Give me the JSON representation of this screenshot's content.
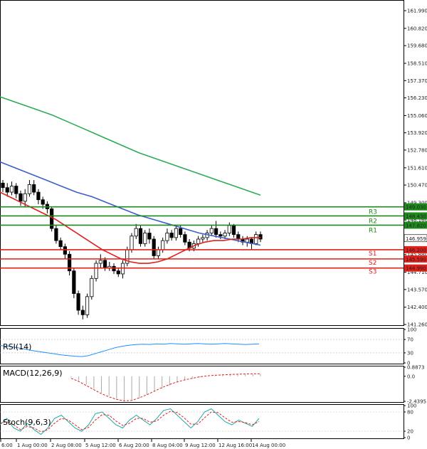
{
  "chart_data": {
    "type": "candlestick",
    "main": {
      "ylim": [
        141.26,
        162.6
      ],
      "y_ticks": [
        "161.990",
        "160.820",
        "159.680",
        "158.510",
        "157.370",
        "156.230",
        "155.060",
        "153.920",
        "152.780",
        "151.610",
        "150.470",
        "149.300",
        "148.160",
        "147.020",
        "146.959",
        "145.880",
        "144.710",
        "143.570",
        "142.400",
        "141.260"
      ],
      "current_price": {
        "label": "146.959",
        "value": 146.959
      },
      "levels": [
        {
          "name": "R3",
          "price_label": "149.030",
          "value": 149.03,
          "color": "#1e8a1e"
        },
        {
          "name": "R2",
          "price_label": "148.430",
          "value": 148.43,
          "color": "#1e8a1e"
        },
        {
          "name": "R1",
          "price_label": "147.820",
          "value": 147.82,
          "color": "#1e8a1e"
        },
        {
          "name": "S1",
          "price_label": "146.200",
          "value": 146.2,
          "color": "#e0201a"
        },
        {
          "name": "S2",
          "price_label": "145.590",
          "value": 145.59,
          "color": "#e0201a"
        },
        {
          "name": "S3",
          "price_label": "144.990",
          "value": 144.99,
          "color": "#e0201a"
        }
      ],
      "candles": [
        [
          150.6,
          150.3,
          150.8,
          150.0
        ],
        [
          150.3,
          150.0,
          150.6,
          149.7
        ],
        [
          150.0,
          150.4,
          150.7,
          149.8
        ],
        [
          150.4,
          149.9,
          150.6,
          149.6
        ],
        [
          149.9,
          149.4,
          150.1,
          149.1
        ],
        [
          149.4,
          149.9,
          150.2,
          149.0
        ],
        [
          149.9,
          150.5,
          150.8,
          149.7
        ],
        [
          150.5,
          150.0,
          150.8,
          149.8
        ],
        [
          150.0,
          149.5,
          150.2,
          149.2
        ],
        [
          149.5,
          149.2,
          149.7,
          148.9
        ],
        [
          149.2,
          148.9,
          149.4,
          148.6
        ],
        [
          148.9,
          147.6,
          149.0,
          147.4
        ],
        [
          147.6,
          146.8,
          147.8,
          146.6
        ],
        [
          146.8,
          146.4,
          147.0,
          146.2
        ],
        [
          146.4,
          145.9,
          146.6,
          145.6
        ],
        [
          145.9,
          144.8,
          146.1,
          144.5
        ],
        [
          144.8,
          143.3,
          145.0,
          143.0
        ],
        [
          143.3,
          142.2,
          143.5,
          141.9
        ],
        [
          142.2,
          141.9,
          142.5,
          141.6
        ],
        [
          141.9,
          143.1,
          143.3,
          141.7
        ],
        [
          143.1,
          144.3,
          144.5,
          142.9
        ],
        [
          144.3,
          145.3,
          145.5,
          144.1
        ],
        [
          145.3,
          145.5,
          145.9,
          145.0
        ],
        [
          145.5,
          145.0,
          145.7,
          144.8
        ],
        [
          145.0,
          145.1,
          145.4,
          144.8
        ],
        [
          145.1,
          144.8,
          145.3,
          144.6
        ],
        [
          144.8,
          144.6,
          145.0,
          144.4
        ],
        [
          144.6,
          145.3,
          145.5,
          144.3
        ],
        [
          145.3,
          146.2,
          146.4,
          145.1
        ],
        [
          146.2,
          147.1,
          147.3,
          146.0
        ],
        [
          147.1,
          147.6,
          147.9,
          146.9
        ],
        [
          147.6,
          146.6,
          147.8,
          146.4
        ],
        [
          146.6,
          147.3,
          147.5,
          146.4
        ],
        [
          147.3,
          146.9,
          147.6,
          146.6
        ],
        [
          146.9,
          145.8,
          147.1,
          145.6
        ],
        [
          145.8,
          146.2,
          146.4,
          145.6
        ],
        [
          146.2,
          146.8,
          147.0,
          146.0
        ],
        [
          146.8,
          147.3,
          147.6,
          146.6
        ],
        [
          147.3,
          147.0,
          147.5,
          146.8
        ],
        [
          147.0,
          147.6,
          147.8,
          146.8
        ],
        [
          147.6,
          147.2,
          147.8,
          147.0
        ],
        [
          147.2,
          146.7,
          147.4,
          146.5
        ],
        [
          146.7,
          146.3,
          146.9,
          146.1
        ],
        [
          146.3,
          146.6,
          146.8,
          146.1
        ],
        [
          146.6,
          146.9,
          147.1,
          146.4
        ],
        [
          146.9,
          147.0,
          147.2,
          146.7
        ],
        [
          147.0,
          147.3,
          147.5,
          146.8
        ],
        [
          147.3,
          147.6,
          147.8,
          147.1
        ],
        [
          147.6,
          147.2,
          148.1,
          147.0
        ],
        [
          147.2,
          147.1,
          147.4,
          146.9
        ],
        [
          147.1,
          147.3,
          147.5,
          146.9
        ],
        [
          147.3,
          147.8,
          148.0,
          147.1
        ],
        [
          147.8,
          147.2,
          147.9,
          147.0
        ],
        [
          147.2,
          146.9,
          147.4,
          146.7
        ],
        [
          146.9,
          146.7,
          147.1,
          146.5
        ],
        [
          146.7,
          146.9,
          147.1,
          146.4
        ],
        [
          146.9,
          146.6,
          147.0,
          146.2
        ],
        [
          146.6,
          147.2,
          147.4,
          146.5
        ],
        [
          147.2,
          146.9,
          147.4,
          146.7
        ]
      ],
      "ma_red": [
        150.0,
        149.7,
        149.4,
        149.1,
        148.8,
        148.5,
        148.2,
        147.8,
        147.4,
        147.0,
        146.6,
        146.2,
        145.9,
        145.6,
        145.4,
        145.3,
        145.3,
        145.4,
        145.6,
        145.9,
        146.2,
        146.5,
        146.7,
        146.8,
        146.8,
        146.9,
        146.9,
        147.0,
        147.0
      ],
      "ma_blue": [
        152.0,
        151.6,
        151.2,
        150.8,
        150.4,
        150.0,
        149.7,
        149.3,
        148.9,
        148.5,
        148.2,
        147.9,
        147.6,
        147.3,
        147.1,
        146.9,
        146.7,
        146.5
      ],
      "ma_green": [
        156.3,
        155.9,
        155.5,
        155.1,
        154.6,
        154.1,
        153.6,
        153.1,
        152.6,
        152.2,
        151.8,
        151.4,
        151.0,
        150.6,
        150.2,
        149.8
      ]
    },
    "rsi": {
      "title": "RSI(14)",
      "ticks": [
        "100",
        "70",
        "30",
        "0"
      ],
      "ylim": [
        0,
        100
      ],
      "values": [
        52,
        50,
        47,
        44,
        40,
        36,
        33,
        30,
        27,
        24,
        22,
        20,
        19,
        22,
        28,
        34,
        40,
        46,
        50,
        53,
        55,
        56,
        55,
        57,
        56,
        58,
        57,
        56,
        57,
        58,
        57,
        56,
        57,
        58,
        57,
        56,
        55,
        56,
        57
      ]
    },
    "macd": {
      "title": "MACD(12,26,9)",
      "ticks": [
        "0.8873",
        "0.0",
        "-2.4395"
      ],
      "ylim": [
        -2.4395,
        0.8873
      ],
      "histogram": [
        -0.1,
        -0.4,
        -0.8,
        -1.2,
        -1.6,
        -1.9,
        -2.2,
        -2.35,
        -2.3,
        -2.1,
        -1.8,
        -1.5,
        -1.2,
        -0.9,
        -0.6,
        -0.4,
        -0.2,
        -0.1,
        0.0,
        0.05,
        0.1,
        0.12,
        0.15,
        0.18,
        0.2,
        0.22
      ],
      "signal": [
        -0.2,
        -0.5,
        -0.9,
        -1.3,
        -1.7,
        -2.0,
        -2.25,
        -2.4,
        -2.35,
        -2.1,
        -1.8,
        -1.45,
        -1.1,
        -0.8,
        -0.55,
        -0.35,
        -0.2,
        -0.05,
        0.05,
        0.1,
        0.14,
        0.17,
        0.2,
        0.22,
        0.24,
        0.25
      ]
    },
    "stoch": {
      "title": "Stoch(9,6,3)",
      "ticks": [
        "100",
        "80",
        "20",
        "0"
      ],
      "ylim": [
        0,
        100
      ],
      "main": [
        40,
        60,
        30,
        20,
        45,
        25,
        10,
        30,
        60,
        70,
        50,
        30,
        20,
        40,
        75,
        80,
        60,
        40,
        30,
        55,
        70,
        55,
        40,
        60,
        85,
        90,
        70,
        50,
        30,
        50,
        80,
        90,
        70,
        50,
        40,
        55,
        45,
        35,
        60
      ],
      "signal": [
        45,
        50,
        40,
        25,
        35,
        30,
        18,
        25,
        45,
        60,
        55,
        40,
        25,
        32,
        55,
        72,
        70,
        52,
        38,
        45,
        60,
        60,
        48,
        52,
        70,
        82,
        78,
        62,
        42,
        42,
        62,
        80,
        78,
        62,
        48,
        50,
        47,
        40,
        50
      ]
    },
    "x_ticks": [
      "6:00",
      "1 Aug 00:00",
      "2 Aug 08:00",
      "5 Aug 12:00",
      "6 Aug 20:00",
      "8 Aug 04:00",
      "9 Aug 12:00",
      "12 Aug 16:00",
      "14 Aug 00:00"
    ]
  }
}
